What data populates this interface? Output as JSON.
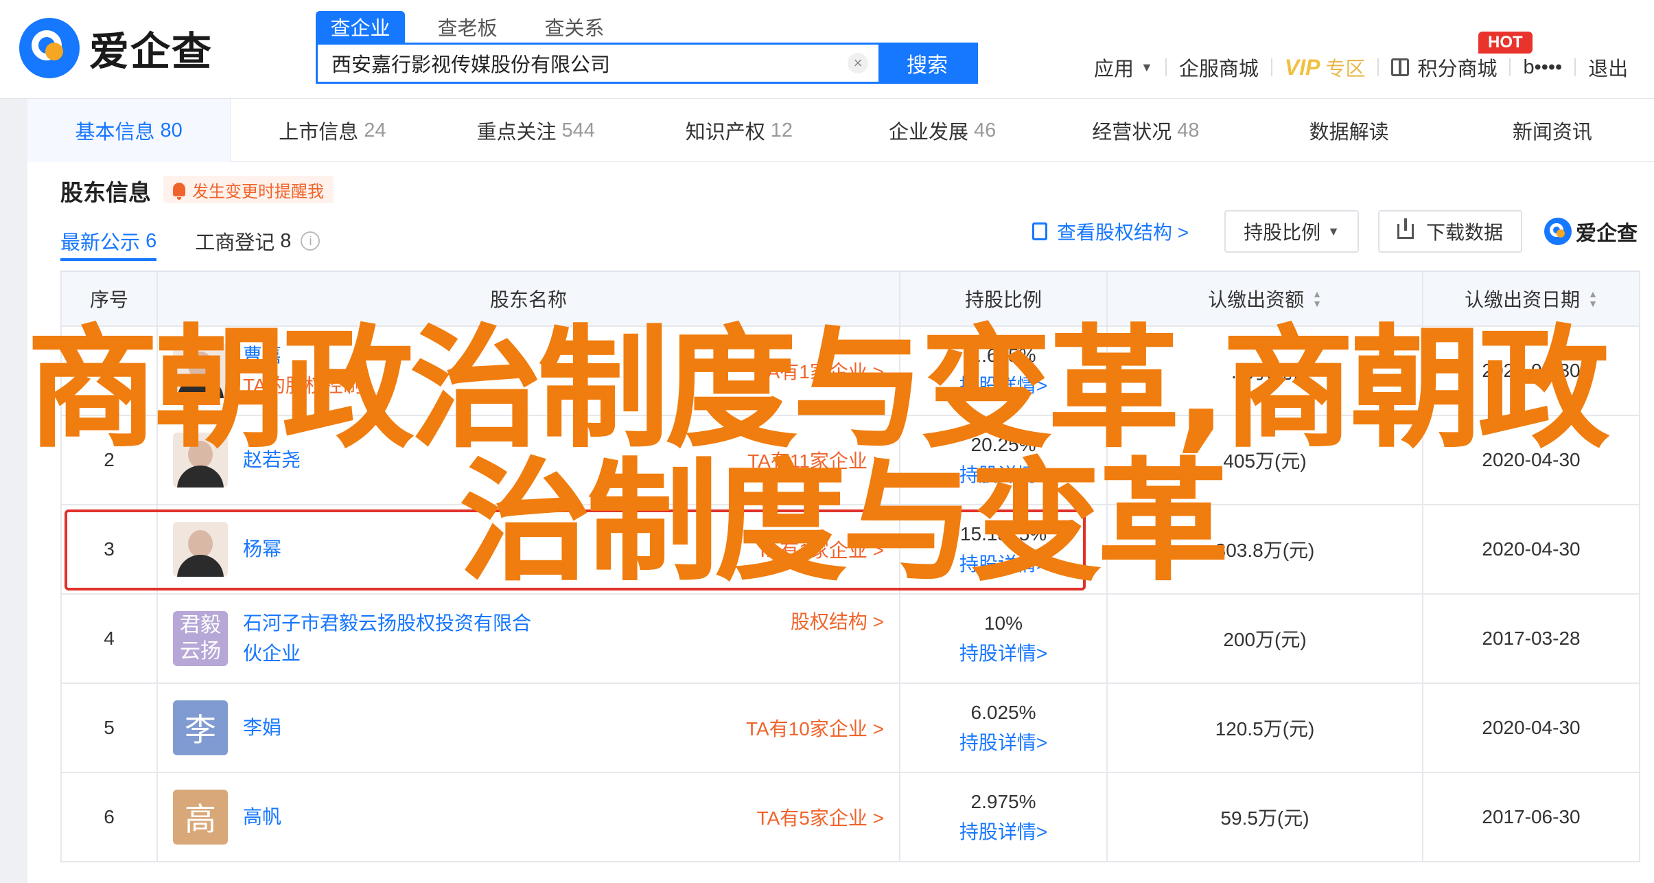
{
  "logo": {
    "text": "爱企查"
  },
  "search": {
    "tabs": [
      "查企业",
      "查老板",
      "查关系"
    ],
    "value": "西安嘉行影视传媒股份有限公司",
    "clear": "×",
    "button": "搜索"
  },
  "nav": {
    "apps": "应用",
    "services": "企服商城",
    "vip": "VIP",
    "vip_sub": "专区",
    "points": "积分商城",
    "hot": "HOT",
    "user": "b••••",
    "logout": "退出"
  },
  "main_tabs": [
    {
      "label": "基本信息",
      "count": "80"
    },
    {
      "label": "上市信息",
      "count": "24"
    },
    {
      "label": "重点关注",
      "count": "544"
    },
    {
      "label": "知识产权",
      "count": "12"
    },
    {
      "label": "企业发展",
      "count": "46"
    },
    {
      "label": "经营状况",
      "count": "48"
    },
    {
      "label": "数据解读",
      "count": ""
    },
    {
      "label": "新闻资讯",
      "count": ""
    }
  ],
  "section": {
    "title": "股东信息",
    "alert": "发生变更时提醒我",
    "sub_tabs": [
      {
        "label": "最新公示",
        "count": "6"
      },
      {
        "label": "工商登记",
        "count": "8"
      }
    ],
    "info": "i",
    "view_structure": "查看股权结构 >",
    "dropdown": "持股比例",
    "download": "下载数据",
    "brand": "爱企查"
  },
  "table": {
    "headers": [
      "序号",
      "股东名称",
      "持股比例",
      "认缴出资额",
      "认缴出资日期"
    ],
    "rows": [
      {
        "no": "1",
        "name": "曹嘉",
        "name2": "TA的股权控制",
        "right": "TA有1家企业 >",
        "avatar": "",
        "pct": "...625%",
        "pct_link": "持股详情>",
        "capital": "...万(元)",
        "date": "2020-04-30"
      },
      {
        "no": "2",
        "name": "赵若尧",
        "name2": "",
        "right": "TA有11家企业 >",
        "avatar": "",
        "pct": "20.25%",
        "pct_link": "持股详情>",
        "capital": "405万(元)",
        "date": "2020-04-30"
      },
      {
        "no": "3",
        "name": "杨幂",
        "name2": "",
        "right": "TA有1家企业 >",
        "avatar": "",
        "pct": "15.1875%",
        "pct_link": "持股详情>",
        "capital": "303.8万(元)",
        "date": "2020-04-30"
      },
      {
        "no": "4",
        "name": "石河子市君毅云扬股权投资有限合",
        "name2": "伙企业",
        "right": "股权结构 >",
        "avatar": "君毅云扬",
        "avatar_a": "君毅",
        "avatar_b": "云扬",
        "pct": "10%",
        "pct_link": "持股详情>",
        "capital": "200万(元)",
        "date": "2017-03-28"
      },
      {
        "no": "5",
        "name": "李娟",
        "name2": "",
        "right": "TA有10家企业 >",
        "avatar": "李",
        "pct": "6.025%",
        "pct_link": "持股详情>",
        "capital": "120.5万(元)",
        "date": "2020-04-30"
      },
      {
        "no": "6",
        "name": "高帆",
        "name2": "",
        "right": "TA有5家企业 >",
        "avatar": "高",
        "pct": "2.975%",
        "pct_link": "持股详情>",
        "capital": "59.5万(元)",
        "date": "2017-06-30"
      }
    ]
  },
  "overlay": {
    "line1": "商朝政治制度与变革,商朝政",
    "line2": "治制度与变革"
  },
  "colors": {
    "accent": "#1677ff",
    "orange": "#f07d0f",
    "warn": "#f0642b",
    "highlight": "#e0322a"
  }
}
